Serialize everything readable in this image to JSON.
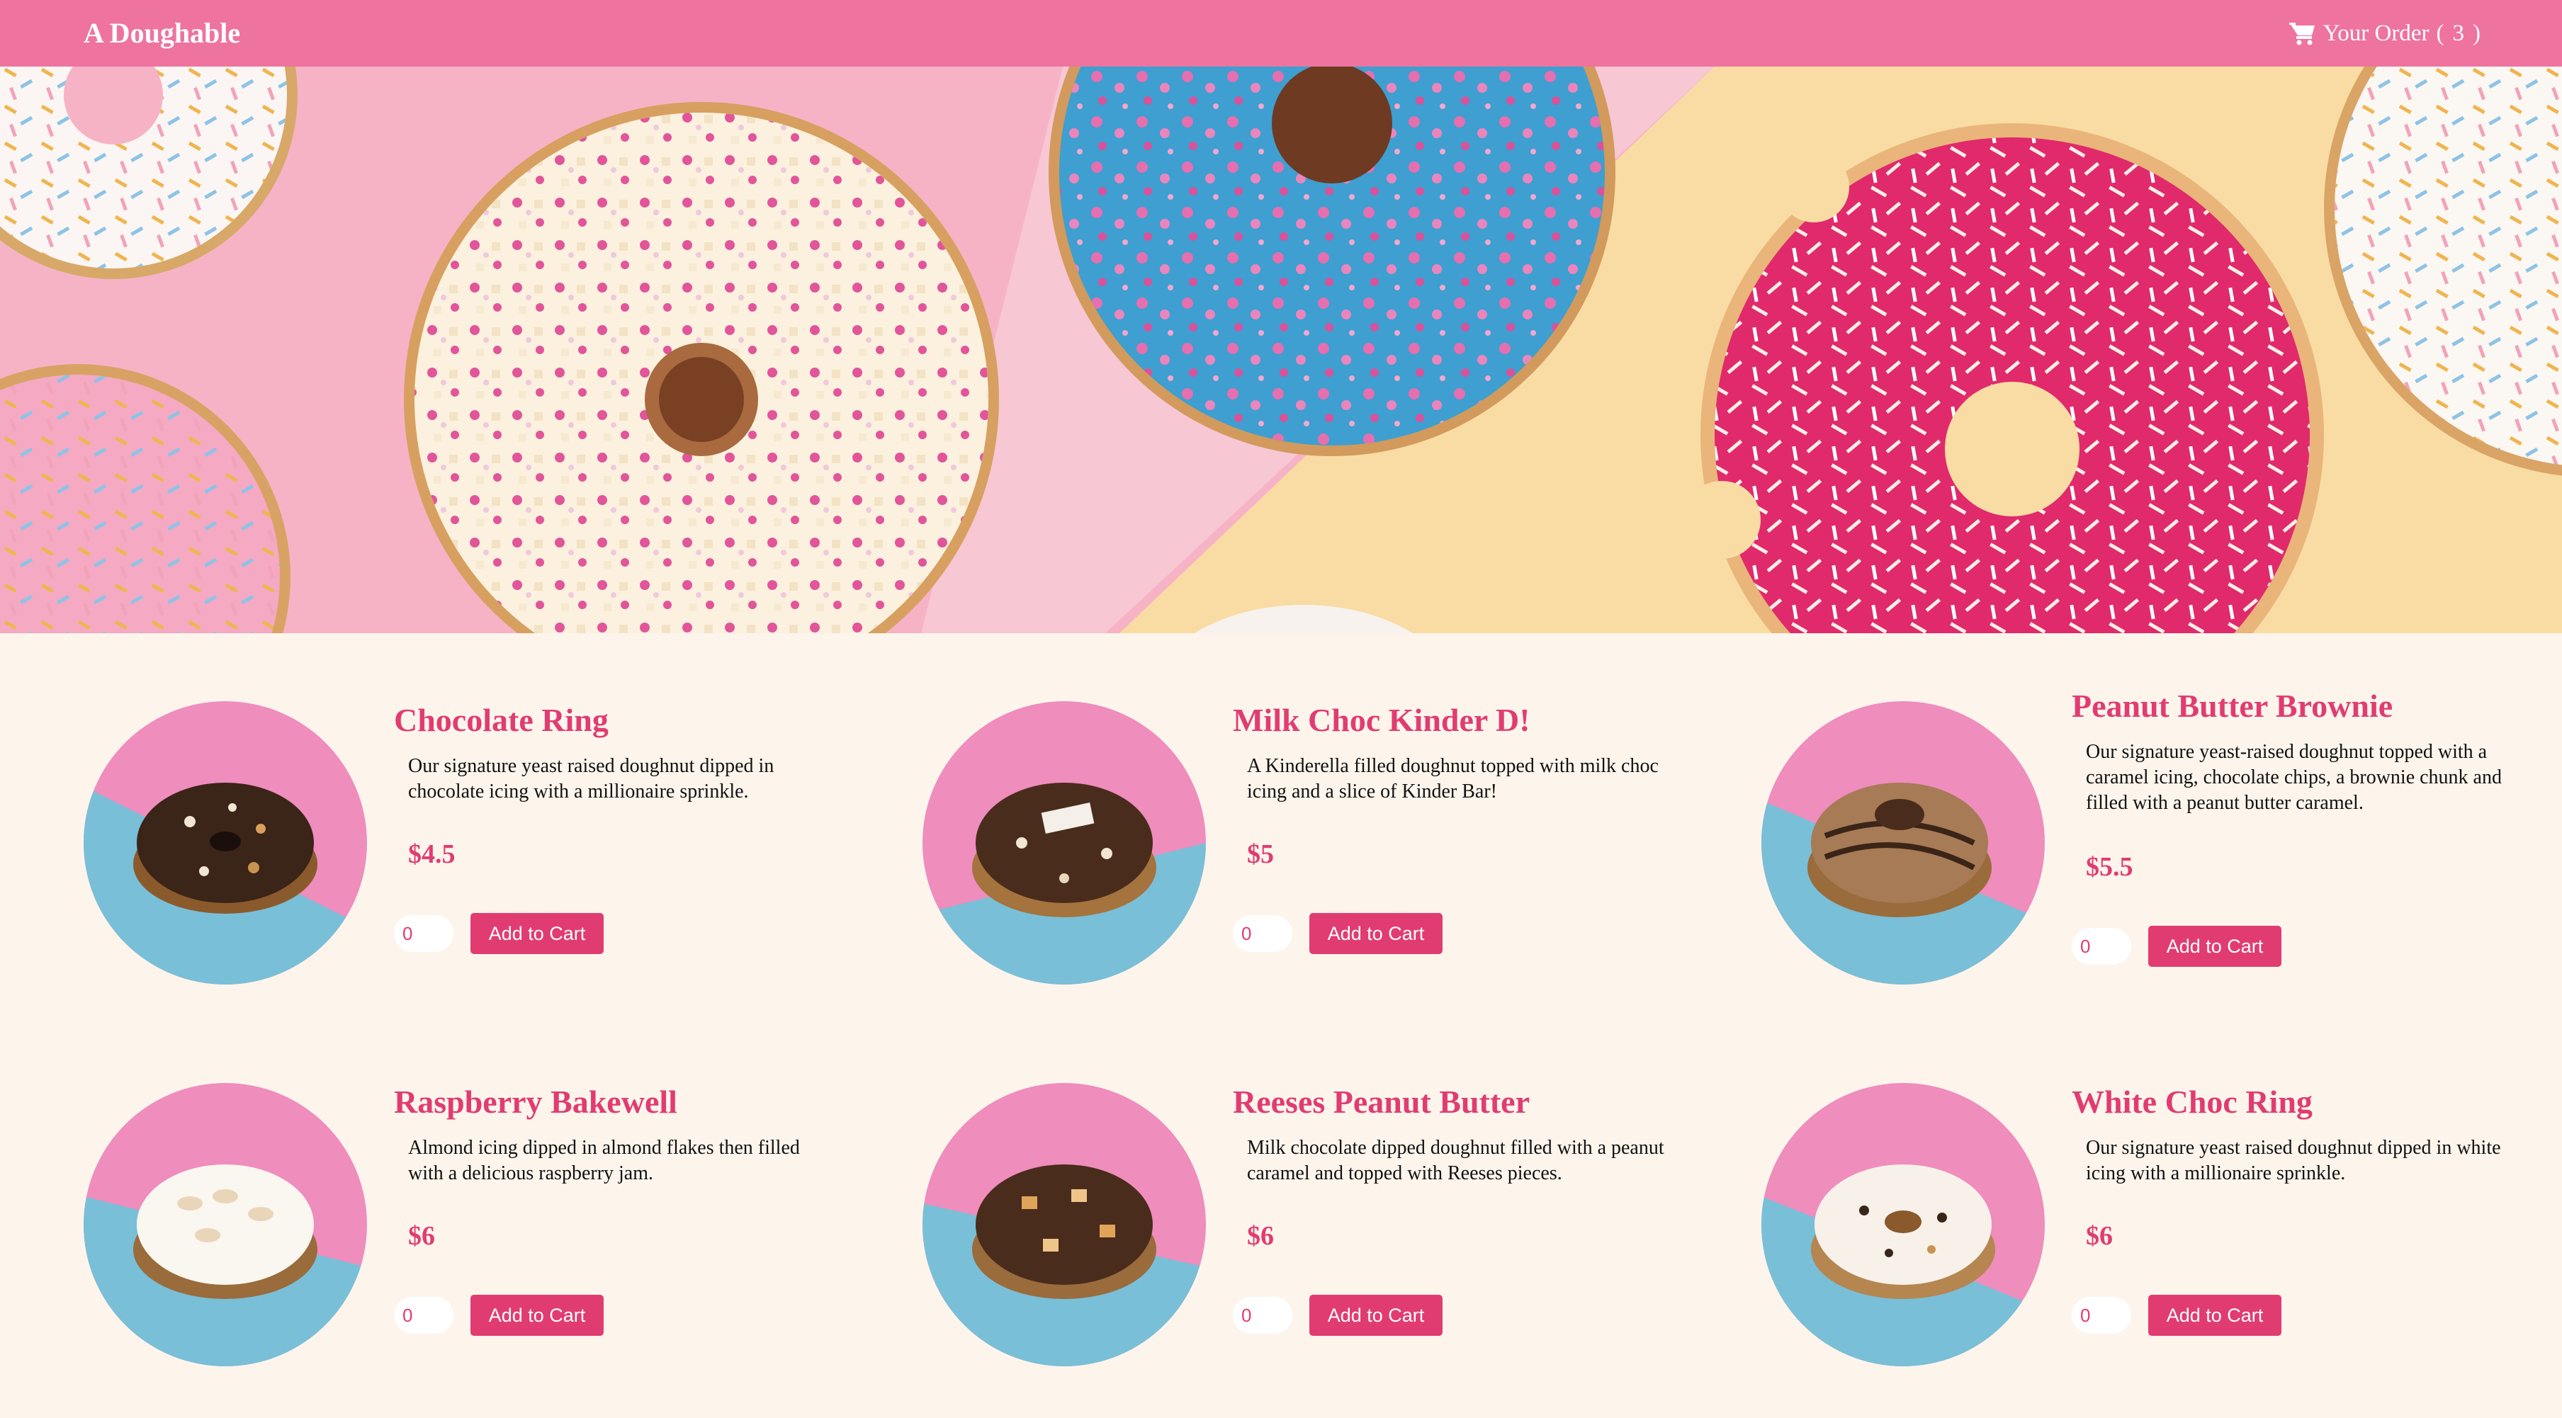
{
  "header": {
    "brand": "A Doughable",
    "order_label": "Your Order",
    "order_open": "(",
    "order_count": "3",
    "order_close": ")",
    "cart_icon": "shopping-cart-icon"
  },
  "colors": {
    "nav": "#ee739f",
    "accent": "#e13c72",
    "page_bg": "#fdf5ec",
    "photo_pink": "#ef8dbd",
    "photo_blue": "#79bfd8"
  },
  "products": [
    {
      "name": "Chocolate Ring",
      "description": "Our signature yeast raised doughnut dipped in chocolate icing with a millionaire sprinkle.",
      "price": "$4.5",
      "quantity": "0",
      "button": "Add to Cart"
    },
    {
      "name": "Milk Choc Kinder D!",
      "description": "A Kinderella filled doughnut topped with milk choc icing and a slice of Kinder Bar!",
      "price": "$5",
      "quantity": "0",
      "button": "Add to Cart"
    },
    {
      "name": "Peanut Butter Brownie",
      "description": "Our signature yeast-raised doughnut topped with a caramel icing, chocolate chips, a brownie chunk and filled with a peanut butter caramel.",
      "price": "$5.5",
      "quantity": "0",
      "button": "Add to Cart"
    },
    {
      "name": "Raspberry Bakewell",
      "description": "Almond icing dipped in almond flakes then filled with a delicious raspberry jam.",
      "price": "$6",
      "quantity": "0",
      "button": "Add to Cart"
    },
    {
      "name": "Reeses Peanut Butter",
      "description": "Milk chocolate dipped doughnut filled with a peanut caramel and topped with Reeses pieces.",
      "price": "$6",
      "quantity": "0",
      "button": "Add to Cart"
    },
    {
      "name": "White Choc Ring",
      "description": "Our signature yeast raised doughnut dipped in white icing with a millionaire sprinkle.",
      "price": "$6",
      "quantity": "0",
      "button": "Add to Cart"
    }
  ]
}
